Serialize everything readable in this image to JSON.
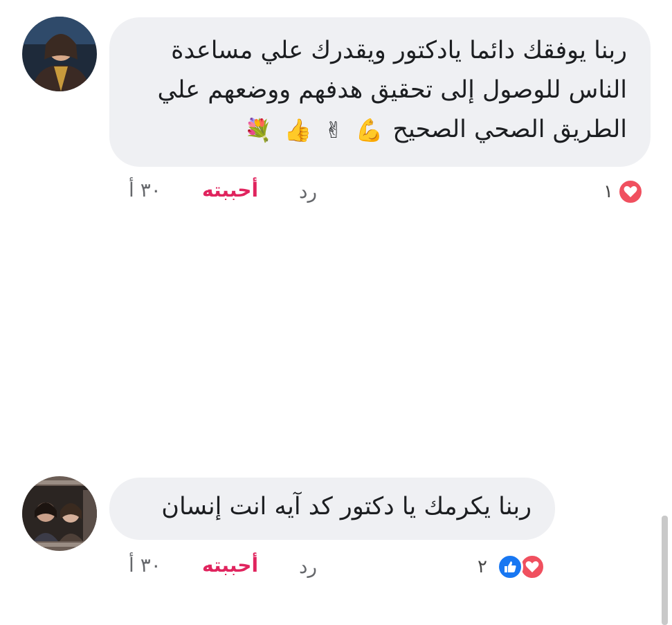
{
  "comments": [
    {
      "lines": [
        "ربنا يوفقك دائما يادكتور ويقدرك علي مساعدة",
        "الناس للوصول إلى تحقيق هدفهم ووضعهم علي",
        "الطريق الصحي الصحيح"
      ],
      "emojis": [
        "💪",
        "✌",
        "👍",
        "💐"
      ],
      "time": "٣٠ أ",
      "like_label": "أحببته",
      "reply_label": "رد",
      "reaction_count": "١",
      "reactions": [
        "heart-icon"
      ]
    },
    {
      "lines": [
        "ربنا يكرمك يا دكتور كد آيه انت إنسان"
      ],
      "time": "٣٠ أ",
      "like_label": "أحببته",
      "reply_label": "رد",
      "reaction_count": "٢",
      "reactions": [
        "heart-icon",
        "thumbs-up-icon"
      ]
    }
  ],
  "colors": {
    "bubble": "#eff0f3",
    "love": "#f0505f",
    "like": "#1877f2",
    "liked_text": "#e0245e"
  }
}
